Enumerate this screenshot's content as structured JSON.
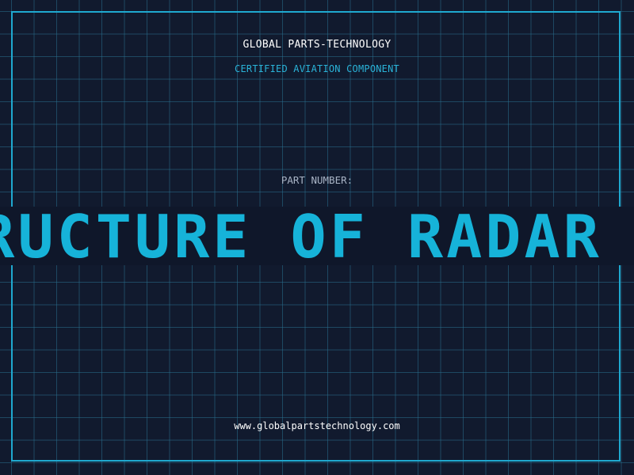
{
  "header": {
    "company": "GLOBAL PARTS-TECHNOLOGY",
    "tagline": "CERTIFIED AVIATION COMPONENT"
  },
  "part": {
    "label": "PART NUMBER:",
    "value": "STRUCTURE OF RADAR SYSTEM"
  },
  "footer": {
    "website": "www.globalpartstechnology.com"
  },
  "colors": {
    "background": "#111a2e",
    "grid": "#286e8c",
    "frame": "#1fa9d0",
    "accent": "#16b3d9",
    "text": "#ffffff",
    "muted": "#a9b4c6"
  }
}
